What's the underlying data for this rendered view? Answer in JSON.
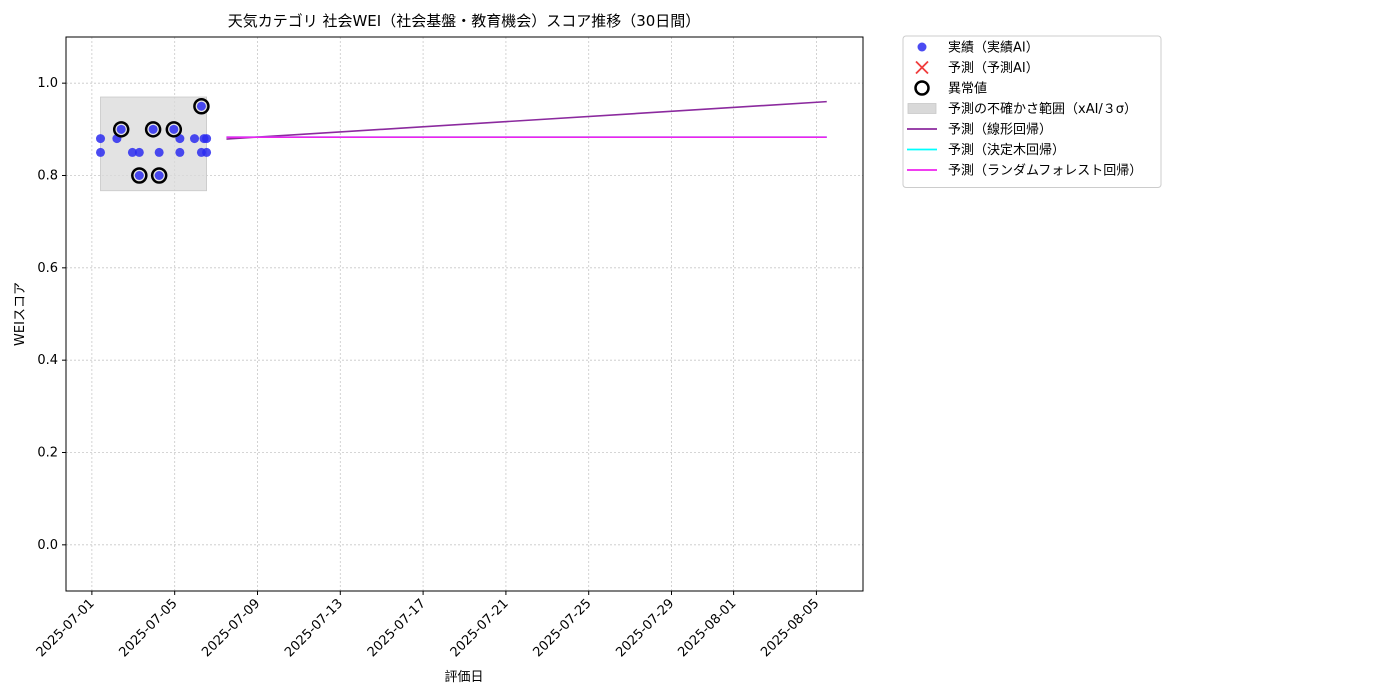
{
  "chart_data": {
    "type": "scatter",
    "title": "天気カテゴリ 社会WEI（社会基盤・教育機会）スコア推移（30日間）",
    "xlabel": "評価日",
    "ylabel": "WEIスコア",
    "xlim": [
      "2025-06-29T18:00",
      "2025-08-07T06:00"
    ],
    "ylim": [
      -0.1,
      1.1
    ],
    "yticks": [
      0.0,
      0.2,
      0.4,
      0.6,
      0.8,
      1.0
    ],
    "ytick_labels": [
      "0.0",
      "0.2",
      "0.4",
      "0.6",
      "0.8",
      "1.0"
    ],
    "xticks": [
      "2025-07-01",
      "2025-07-05",
      "2025-07-09",
      "2025-07-13",
      "2025-07-17",
      "2025-07-21",
      "2025-07-25",
      "2025-07-29",
      "2025-08-01",
      "2025-08-05"
    ],
    "grid": true,
    "legend_position": "outside-top-right",
    "uncertainty_band": {
      "x": [
        "2025-07-01T10:00",
        "2025-07-06T13:00"
      ],
      "y": [
        0.767,
        0.97
      ],
      "color": "#d9d9d9"
    },
    "series": [
      {
        "name": "実績（実績AI）",
        "kind": "scatter",
        "color": "#2b2bf0",
        "points": [
          {
            "x": "2025-07-01T10:00",
            "y": 0.88
          },
          {
            "x": "2025-07-01T10:00",
            "y": 0.85
          },
          {
            "x": "2025-07-02T05:00",
            "y": 0.88
          },
          {
            "x": "2025-07-02T10:00",
            "y": 0.9
          },
          {
            "x": "2025-07-02T23:00",
            "y": 0.85
          },
          {
            "x": "2025-07-03T07:00",
            "y": 0.85
          },
          {
            "x": "2025-07-03T07:00",
            "y": 0.8
          },
          {
            "x": "2025-07-03T23:00",
            "y": 0.9
          },
          {
            "x": "2025-07-04T06:00",
            "y": 0.85
          },
          {
            "x": "2025-07-04T06:00",
            "y": 0.8
          },
          {
            "x": "2025-07-04T23:00",
            "y": 0.9
          },
          {
            "x": "2025-07-05T06:00",
            "y": 0.88
          },
          {
            "x": "2025-07-05T06:00",
            "y": 0.85
          },
          {
            "x": "2025-07-05T23:00",
            "y": 0.88
          },
          {
            "x": "2025-07-06T07:00",
            "y": 0.95
          },
          {
            "x": "2025-07-06T07:00",
            "y": 0.85
          },
          {
            "x": "2025-07-06T10:00",
            "y": 0.88
          },
          {
            "x": "2025-07-06T13:00",
            "y": 0.88
          },
          {
            "x": "2025-07-06T13:00",
            "y": 0.85
          }
        ]
      },
      {
        "name": "予測（予測AI）",
        "kind": "scatter-x",
        "color": "#f03c3c",
        "points": []
      },
      {
        "name": "異常値",
        "kind": "outlier",
        "color": "#000000",
        "points": [
          {
            "x": "2025-07-02T10:00",
            "y": 0.9
          },
          {
            "x": "2025-07-03T07:00",
            "y": 0.8
          },
          {
            "x": "2025-07-03T23:00",
            "y": 0.9
          },
          {
            "x": "2025-07-04T06:00",
            "y": 0.8
          },
          {
            "x": "2025-07-04T23:00",
            "y": 0.9
          },
          {
            "x": "2025-07-06T07:00",
            "y": 0.95
          }
        ]
      },
      {
        "name": "予測（線形回帰）",
        "kind": "line",
        "color": "#8b2a9e",
        "points": [
          {
            "x": "2025-07-07T12:00",
            "y": 0.879
          },
          {
            "x": "2025-08-05T12:00",
            "y": 0.96
          }
        ]
      },
      {
        "name": "予測（決定木回帰）",
        "kind": "line",
        "color": "#00ffff",
        "points": [
          {
            "x": "2025-07-07T12:00",
            "y": 0.883
          },
          {
            "x": "2025-08-05T12:00",
            "y": 0.883
          }
        ]
      },
      {
        "name": "予測（ランダムフォレスト回帰）",
        "kind": "line",
        "color": "#ee22ee",
        "points": [
          {
            "x": "2025-07-07T12:00",
            "y": 0.883
          },
          {
            "x": "2025-08-05T12:00",
            "y": 0.883
          }
        ]
      }
    ],
    "legend": [
      {
        "label": "実績（実績AI）",
        "marker": "dot",
        "color": "#2b2bf0"
      },
      {
        "label": "予測（予測AI）",
        "marker": "x",
        "color": "#f03c3c"
      },
      {
        "label": "異常値",
        "marker": "ring",
        "color": "#000000"
      },
      {
        "label": "予測の不確かさ範囲（xAI/３σ）",
        "marker": "patch",
        "color": "#d9d9d9"
      },
      {
        "label": "予測（線形回帰）",
        "marker": "line",
        "color": "#8b2a9e"
      },
      {
        "label": "予測（決定木回帰）",
        "marker": "line",
        "color": "#00ffff"
      },
      {
        "label": "予測（ランダムフォレスト回帰）",
        "marker": "line",
        "color": "#ee22ee"
      }
    ]
  }
}
